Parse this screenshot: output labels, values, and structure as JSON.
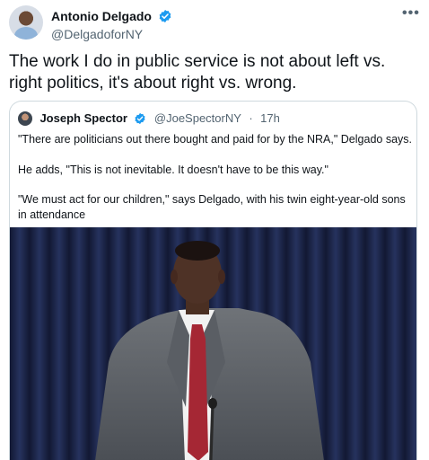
{
  "author": {
    "name": "Antonio Delgado",
    "handle": "@DelgadoforNY"
  },
  "menu": {
    "more_label": "•••"
  },
  "tweet": {
    "text": "The work I do in public service is not about left vs. right politics, it's about right vs. wrong."
  },
  "quoted": {
    "name": "Joseph Spector",
    "handle": "@JoeSpectorNY",
    "separator": "·",
    "time": "17h",
    "paragraphs": [
      "\"There are politicians out there bought and paid for by the NRA,\" Delgado says.",
      "He adds, \"This is not inevitable. It doesn't have to be this way.\"",
      "\"We must act for our children,\" says Delgado, with his twin eight-year-old sons in attendance"
    ]
  },
  "colors": {
    "verified_blue": "#1d9bf0",
    "text_primary": "#0f1419",
    "text_secondary": "#536471",
    "border": "#cfd9de",
    "curtain": "#1f2a4f"
  },
  "icons": {
    "verified": "verified-badge-icon",
    "more": "more-horizontal-icon",
    "microphone": "microphone-icon"
  }
}
